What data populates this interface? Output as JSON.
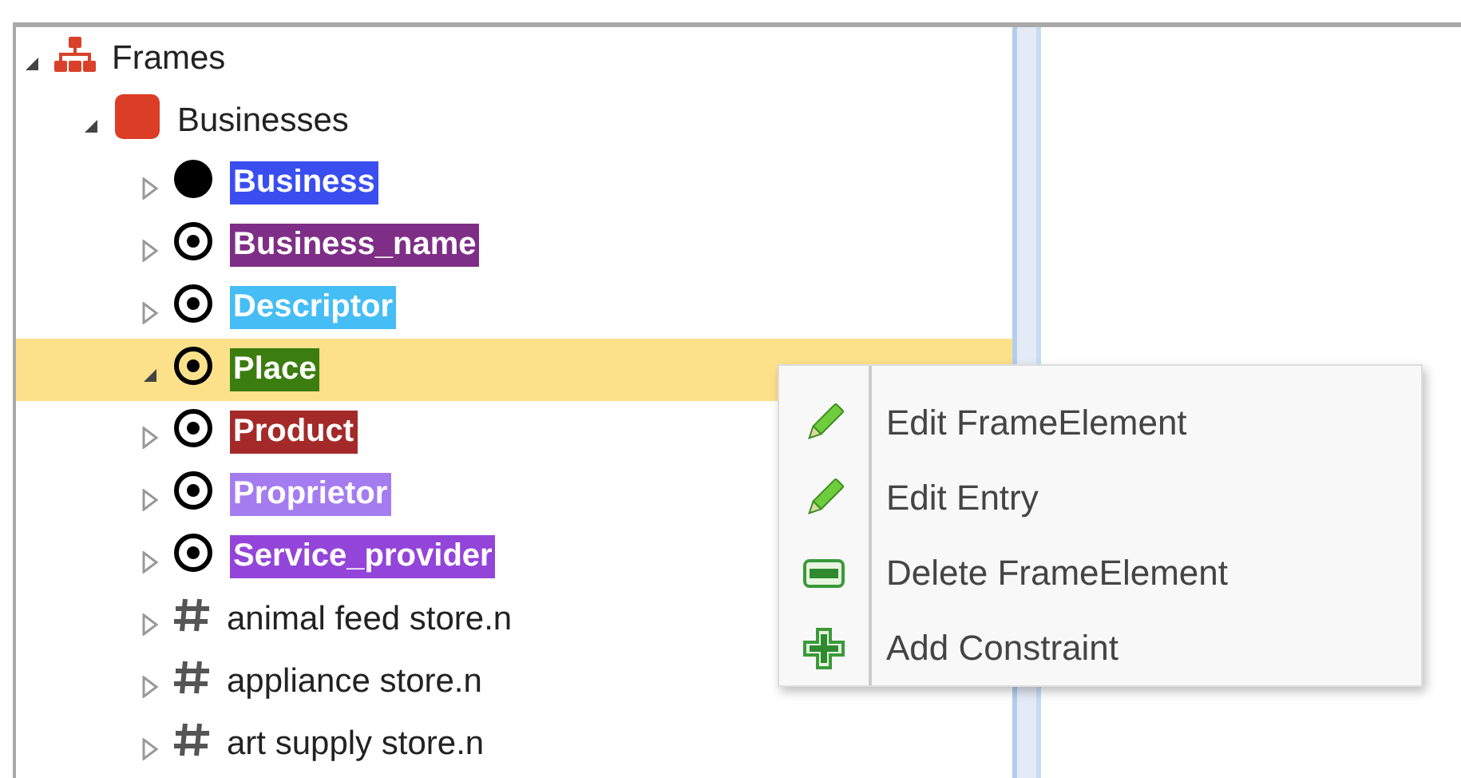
{
  "tree": [
    {
      "label": "Frames",
      "kind": "root",
      "expanded": true,
      "selected": false,
      "children": [
        {
          "label": "Businesses",
          "kind": "frame",
          "expanded": true,
          "selected": false,
          "children": [
            {
              "label": "Business",
              "kind": "core",
              "color": "#3a4ef0",
              "expanded": false,
              "selected": false
            },
            {
              "label": "Business_name",
              "kind": "peripheral",
              "color": "#7e2e86",
              "expanded": false,
              "selected": false
            },
            {
              "label": "Descriptor",
              "kind": "peripheral",
              "color": "#45bdf5",
              "expanded": false,
              "selected": false
            },
            {
              "label": "Place",
              "kind": "peripheral",
              "color": "#3b7d0e",
              "expanded": true,
              "selected": true
            },
            {
              "label": "Product",
              "kind": "peripheral",
              "color": "#a42a2a",
              "expanded": false,
              "selected": false
            },
            {
              "label": "Proprietor",
              "kind": "peripheral",
              "color": "#a47cf0",
              "expanded": false,
              "selected": false
            },
            {
              "label": "Service_provider",
              "kind": "peripheral",
              "color": "#9445d9",
              "expanded": false,
              "selected": false
            },
            {
              "label": "animal feed store.n",
              "kind": "lexunit",
              "expanded": false,
              "selected": false
            },
            {
              "label": "appliance store.n",
              "kind": "lexunit",
              "expanded": false,
              "selected": false
            },
            {
              "label": "art supply store.n",
              "kind": "lexunit",
              "expanded": false,
              "selected": false
            }
          ]
        }
      ]
    }
  ],
  "context_menu": [
    {
      "label": "Edit FrameElement",
      "kind": "edit"
    },
    {
      "label": "Edit Entry",
      "kind": "edit"
    },
    {
      "label": "Delete FrameElement",
      "kind": "delete"
    },
    {
      "label": "Add Constraint",
      "kind": "add"
    }
  ]
}
